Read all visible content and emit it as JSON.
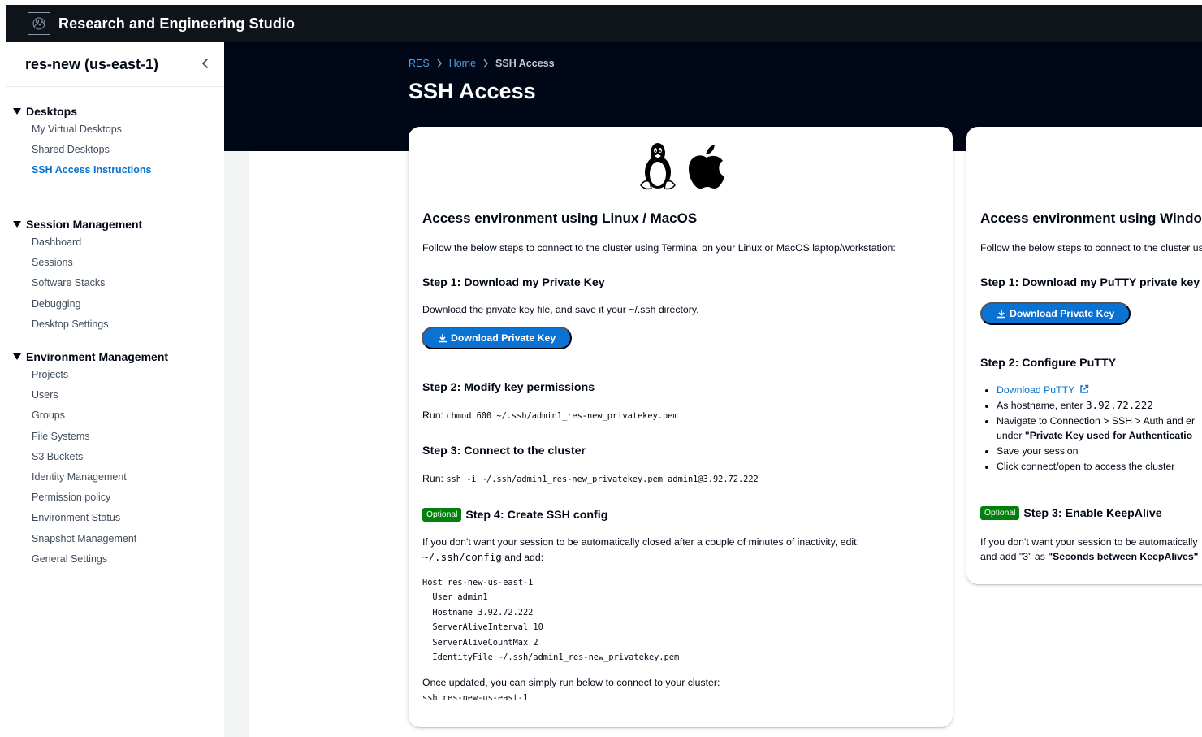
{
  "app": {
    "title": "Research and Engineering Studio"
  },
  "sidebar": {
    "title": "res-new (us-east-1)",
    "sections": [
      {
        "label": "Desktops",
        "items": [
          {
            "label": "My Virtual Desktops"
          },
          {
            "label": "Shared Desktops"
          },
          {
            "label": "SSH Access Instructions",
            "active": true
          }
        ]
      },
      {
        "label": "Session Management",
        "items": [
          {
            "label": "Dashboard"
          },
          {
            "label": "Sessions"
          },
          {
            "label": "Software Stacks"
          },
          {
            "label": "Debugging"
          },
          {
            "label": "Desktop Settings"
          }
        ]
      },
      {
        "label": "Environment Management",
        "items": [
          {
            "label": "Projects"
          },
          {
            "label": "Users"
          },
          {
            "label": "Groups"
          },
          {
            "label": "File Systems"
          },
          {
            "label": "S3 Buckets"
          },
          {
            "label": "Identity Management"
          },
          {
            "label": "Permission policy"
          },
          {
            "label": "Environment Status"
          },
          {
            "label": "Snapshot Management"
          },
          {
            "label": "General Settings"
          }
        ]
      }
    ]
  },
  "breadcrumbs": [
    {
      "label": "RES"
    },
    {
      "label": "Home"
    },
    {
      "label": "SSH Access"
    }
  ],
  "page": {
    "title": "SSH Access"
  },
  "linux_card": {
    "title": "Access environment using Linux / MacOS",
    "intro": "Follow the below steps to connect to the cluster using Terminal on your Linux or MacOS laptop/workstation:",
    "step1_title": "Step 1: Download my Private Key",
    "step1_text": "Download the private key file, and save it your ~/.ssh directory.",
    "download_button": "Download Private Key",
    "step2_title": "Step 2: Modify key permissions",
    "run_label": "Run:",
    "step2_cmd": "chmod 600 ~/.ssh/admin1_res-new_privatekey.pem",
    "step3_title": "Step 3: Connect to the cluster",
    "step3_cmd": "ssh -i ~/.ssh/admin1_res-new_privatekey.pem admin1@3.92.72.222",
    "optional_badge": "Optional",
    "step4_title": "Step 4: Create SSH config",
    "step4_text": "If you don't want your session to be automatically closed after a couple of minutes of inactivity, edit:",
    "step4_path": "~/.ssh/config",
    "step4_and": "and add:",
    "config_lines": [
      "Host res-new-us-east-1",
      "  User admin1",
      "  Hostname 3.92.72.222",
      "  ServerAliveInterval 10",
      "  ServerAliveCountMax 2",
      "  IdentityFile ~/.ssh/admin1_res-new_privatekey.pem"
    ],
    "outro": "Once updated, you can simply run below to connect to your cluster:",
    "outro_cmd": "ssh res-new-us-east-1"
  },
  "windows_card": {
    "title": "Access environment using Windo",
    "intro": "Follow the below steps to connect to the cluster us",
    "step1_title": "Step 1: Download my PuTTY private key",
    "download_button": "Download Private Key",
    "step2_title": "Step 2: Configure PuTTY",
    "download_putty": "Download PuTTY",
    "hostname_prefix": "As hostname, enter",
    "hostname": "3.92.72.222",
    "navigate_text": "Navigate to Connection > SSH > Auth and er",
    "under_prefix": "under",
    "under_bold": "\"Private Key used for Authenticatio",
    "save_session": "Save your session",
    "click_connect": "Click connect/open to access the cluster",
    "optional_badge": "Optional",
    "step3_title": "Step 3: Enable KeepAlive",
    "keepalive_text": "If you don't want your session to be automatically",
    "keepalive_prefix": "and add \"3\" as",
    "keepalive_bold": "\"Seconds between KeepAlives\""
  },
  "colors": {
    "accent": "#0972d3",
    "header_bg": "#000716",
    "optional_badge": "#037f0c"
  }
}
